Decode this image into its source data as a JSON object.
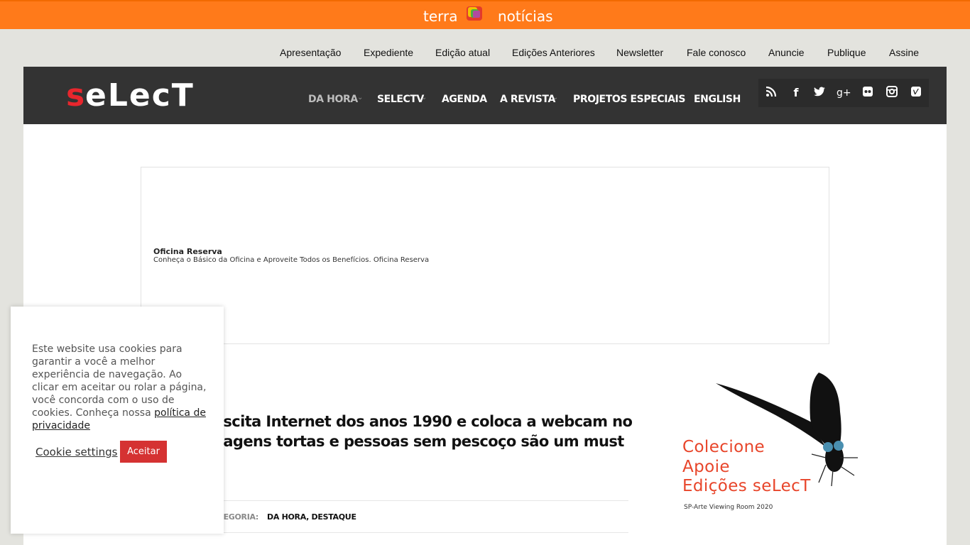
{
  "terra": {
    "brand": "terra",
    "section": "notícias",
    "bar_color": "#ff7a1a"
  },
  "util_nav": [
    "Apresentação",
    "Expediente",
    "Edição atual",
    "Edições Anteriores",
    "Newsletter",
    "Fale conosco",
    "Anuncie",
    "Publique",
    "Assine"
  ],
  "header": {
    "logo": "seLecT",
    "logo_accent": "#e8262d",
    "nav": [
      "DA HORA",
      "SELECTV",
      "AGENDA",
      "A REVISTA",
      "PROJETOS ESPECIAIS",
      "ENGLISH"
    ],
    "social_icons": [
      "rss-icon",
      "facebook-icon",
      "twitter-icon",
      "google-plus-icon",
      "flickr-icon",
      "instagram-icon",
      "vimeo-icon"
    ]
  },
  "ad": {
    "title": "Oficina Reserva",
    "subtitle": "Conheça o Básico da Oficina e Aproveite Todos os Benefícios. Oficina Reserva"
  },
  "article": {
    "headline_line1": "uscita Internet dos anos 1990 e coloca a webcam no",
    "headline_line2": "nagens tortas e pessoas sem pescoço são um must",
    "meta_label": "ATEGORIA:",
    "categories": "DA HORA, DESTAQUE"
  },
  "side_ad": {
    "lines": [
      "Colecione",
      "Apoie",
      "Edições seLecT"
    ],
    "small": "SP-Arte Viewing Room 2020",
    "accent": "#e8452a"
  },
  "cookie": {
    "text": "Este website usa cookies para garantir a você a melhor experiência de navegação. Ao clicar em aceitar ou rolar a página, você concorda com o uso de cookies. Conheça nossa ",
    "policy_link": "política de privacidade",
    "settings_label": "Cookie settings",
    "accept_label": "Aceitar",
    "accept_color": "#d53232"
  }
}
